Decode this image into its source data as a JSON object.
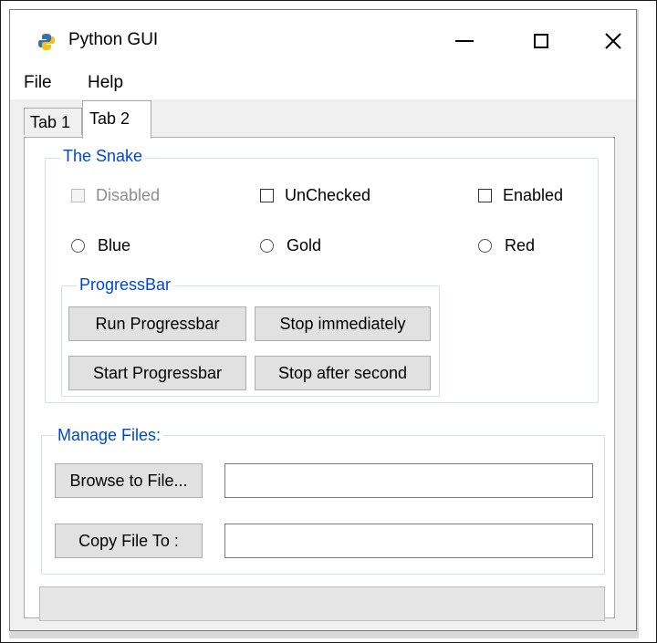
{
  "window": {
    "title": "Python GUI",
    "controls": {
      "minimize": "minimize-icon",
      "maximize": "maximize-icon",
      "close": "close-icon"
    }
  },
  "menu": {
    "items": [
      "File",
      "Help"
    ]
  },
  "tabs": [
    {
      "label": "Tab 1",
      "selected": false
    },
    {
      "label": "Tab 2",
      "selected": true
    }
  ],
  "snake": {
    "label": "The Snake",
    "checkboxes": [
      {
        "label": "Disabled",
        "checked": false,
        "enabled": false
      },
      {
        "label": "UnChecked",
        "checked": false,
        "enabled": true
      },
      {
        "label": "Enabled",
        "checked": false,
        "enabled": true
      }
    ],
    "radios": [
      {
        "label": "Blue",
        "selected": false
      },
      {
        "label": "Gold",
        "selected": false
      },
      {
        "label": "Red",
        "selected": false
      }
    ],
    "progress": {
      "label": "ProgressBar",
      "buttons": [
        "Run Progressbar",
        "Stop immediately",
        "Start Progressbar",
        "Stop after second"
      ]
    }
  },
  "files": {
    "label": "Manage Files:",
    "browse_label": "Browse to File...",
    "copy_label": "Copy File To :",
    "browse_value": "",
    "copy_value": ""
  },
  "progressbar": {
    "value": 0
  }
}
